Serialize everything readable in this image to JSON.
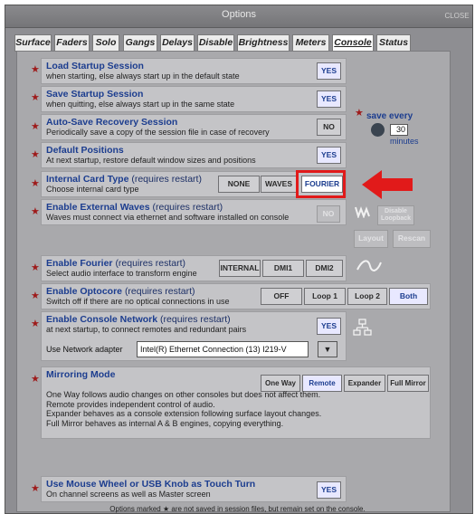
{
  "window": {
    "title": "Options",
    "close_label": "CLOSE"
  },
  "tabs": [
    "Surface",
    "Faders",
    "Solo",
    "Gangs",
    "Delays",
    "Disable",
    "Brightness",
    "Meters",
    "Console",
    "Status"
  ],
  "active_tab": "Console",
  "rows": {
    "load": {
      "name": "Load Startup Session",
      "desc": "when starting, else always start up in the default state",
      "btn": "YES"
    },
    "save": {
      "name": "Save Startup Session",
      "desc": "when quitting, else always start up in the same state",
      "btn": "YES"
    },
    "autosave": {
      "name": "Auto-Save Recovery Session",
      "desc": "Periodically save a copy of the session file in case of recovery",
      "btn": "NO"
    },
    "positions": {
      "name": "Default Positions",
      "desc": "At next startup, restore default window sizes and positions",
      "btn": "YES"
    },
    "card": {
      "name": "Internal Card Type",
      "note": "(requires restart)",
      "desc": "Choose internal card type",
      "opts": [
        "NONE",
        "WAVES",
        "FOURIER"
      ]
    },
    "waves": {
      "name": "Enable External Waves",
      "note": "(requires restart)",
      "desc": "Waves must connect via ethernet and software installed on console",
      "btn": "NO",
      "disable_loopback": "Disable Loopback",
      "layout": "Layout",
      "rescan": "Rescan"
    },
    "fourier": {
      "name": "Enable Fourier",
      "note": "(requires restart)",
      "desc": "Select audio interface to transform engine",
      "opts": [
        "INTERNAL",
        "DMI1",
        "DMI2"
      ]
    },
    "optocore": {
      "name": "Enable Optocore",
      "note": "(requires restart)",
      "desc": "Switch off if there are no optical connections in use",
      "opts": [
        "OFF",
        "Loop 1",
        "Loop 2",
        "Both"
      ]
    },
    "network": {
      "name": "Enable Console Network",
      "note": "(requires restart)",
      "desc": "at next startup, to connect remotes and redundant pairs",
      "btn": "YES",
      "adapter_label": "Use Network adapter",
      "adapter_value": "Intel(R) Ethernet Connection (13) I219-V"
    },
    "mirroring": {
      "name": "Mirroring Mode",
      "opts": [
        "One Way",
        "Remote",
        "Expander",
        "Full Mirror"
      ],
      "lines": [
        "One Way follows audio changes on other consoles but does not affect them.",
        "Remote provides independent control of audio.",
        "Expander behaves as a console extension following surface layout changes.",
        "Full Mirror behaves as internal A & B engines, copying everything."
      ]
    },
    "mouse": {
      "name": "Use Mouse Wheel or USB Knob as Touch Turn",
      "desc": "On channel screens as well as Master screen",
      "btn": "YES"
    }
  },
  "save_every": {
    "label": "save every",
    "value": "30",
    "unit": "minutes"
  },
  "footer": "Options marked ★ are not saved in session files, but remain set on the console.",
  "colors": {
    "highlight": "#e11a1a",
    "accent": "#1c3d8f"
  }
}
